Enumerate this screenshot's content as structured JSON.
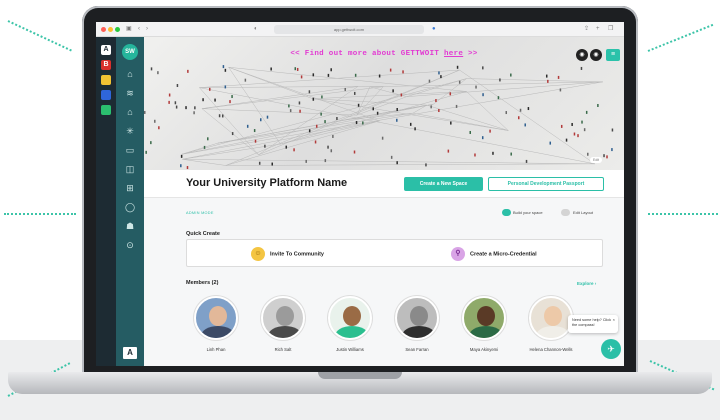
{
  "browser": {
    "url": "app.gettwoit.com"
  },
  "workspaces": [
    {
      "letter": "A",
      "color": "#ffffff",
      "text": "#1d2b33"
    },
    {
      "letter": "B",
      "color": "#d9302c",
      "text": "#ffffff"
    },
    {
      "letter": "",
      "color": "#f2c233",
      "text": "#ffffff"
    },
    {
      "letter": "",
      "color": "#2f66d9",
      "text": "#ffffff"
    },
    {
      "letter": "",
      "color": "#2bbf6f",
      "text": "#ffffff"
    }
  ],
  "sidebar": {
    "avatar_initials": "SW",
    "bottom_logo": "A",
    "items": [
      {
        "icon": "home-icon",
        "glyph": "⌂"
      },
      {
        "icon": "layers-icon",
        "glyph": "≋"
      },
      {
        "icon": "building-icon",
        "glyph": "⌂"
      },
      {
        "icon": "network-icon",
        "glyph": "✳"
      },
      {
        "icon": "calendar-icon",
        "glyph": "▭"
      },
      {
        "icon": "book-icon",
        "glyph": "◫"
      },
      {
        "icon": "grid-icon",
        "glyph": "⊞"
      },
      {
        "icon": "chat-icon",
        "glyph": "◯"
      },
      {
        "icon": "people-icon",
        "glyph": "☗"
      },
      {
        "icon": "settings-icon",
        "glyph": "⊙"
      }
    ]
  },
  "banner": {
    "promo_prefix": "<< Find out more about GETTWOIT ",
    "promo_link": "here",
    "promo_suffix": " >>",
    "edit_label": "Edit"
  },
  "header": {
    "title": "Your University Platform Name",
    "create_space_label": "Create a New Space",
    "passport_label": "Personal Development Passport"
  },
  "admin": {
    "mode_label": "ADMIN MODE",
    "build_label": "Build your space",
    "edit_layout_label": "Edit Layout"
  },
  "quick_create": {
    "title": "Quick Create",
    "invite_label": "Invite To Community",
    "micro_label": "Create a Micro-Credential"
  },
  "members": {
    "title": "Members (2)",
    "explore_label": "Explore",
    "list": [
      {
        "name": "Linh Phan",
        "bg": "#7fa0c8",
        "skin": "#e2b899",
        "shirt": "#3c4a66"
      },
      {
        "name": "Rich Salt",
        "bg": "#cfcfcf",
        "skin": "#9b9b9b",
        "shirt": "#4a4a4a"
      },
      {
        "name": "Justin Williams",
        "bg": "#e9f2ec",
        "skin": "#9a6b45",
        "shirt": "#2bbf8f"
      },
      {
        "name": "Sean Farran",
        "bg": "#bdbdbd",
        "skin": "#8a8a8a",
        "shirt": "#2e2e2e"
      },
      {
        "name": "Maya Akinyemi",
        "bg": "#8faa6a",
        "skin": "#5a3a26",
        "shirt": "#2b6a45"
      },
      {
        "name": "Helena Channon-Wells",
        "bg": "#e8e1d6",
        "skin": "#edc9a8",
        "shirt": "#f0eee8"
      }
    ]
  },
  "help": {
    "text": "Need some help? Click the compass!"
  },
  "colors": {
    "accent": "#2bbfa7",
    "promo": "#e23ad2",
    "sidebar_dark": "#1d2b33",
    "sidebar_teal": "#255c63"
  }
}
